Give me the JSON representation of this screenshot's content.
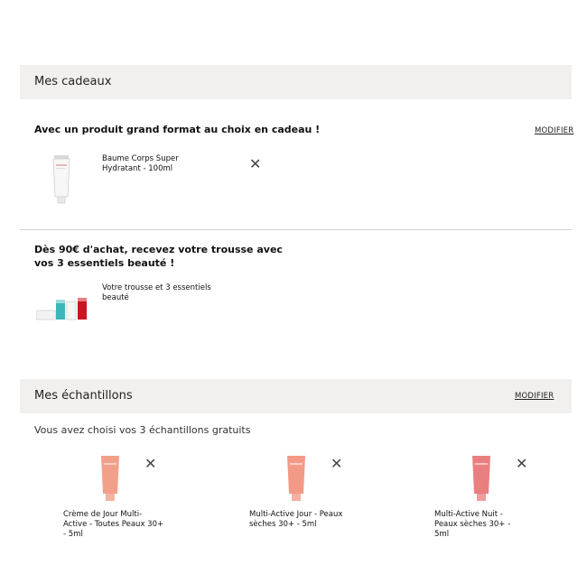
{
  "gifts": {
    "header_title": "Mes cadeaux",
    "offer1": {
      "title": "Avec un produit grand format au choix en cadeau !",
      "modify_label": "MODIFIER",
      "item_name": "Baume Corps Super Hydratant - 100ml",
      "image_icon": "white-body-balm-tube-icon",
      "remove_icon": "close-icon"
    },
    "offer2": {
      "title": "Dès 90€ d'achat, recevez votre trousse avec vos 3 essentiels beauté !",
      "item_name": "Votre trousse et 3 essentiels beauté",
      "image_icon": "pouch-and-three-minis-icon"
    }
  },
  "samples": {
    "header_title": "Mes échantillons",
    "modify_label": "MODIFIER",
    "subtitle": "Vous avez choisi vos 3 échantillons gratuits",
    "items": [
      {
        "name": "Crème de Jour Multi-Active - Toutes Peaux 30+ - 5ml",
        "tube_color": "#f2a08a",
        "remove_icon": "close-icon"
      },
      {
        "name": "Multi-Active Jour - Peaux sèches 30+ - 5ml",
        "tube_color": "#f29a86",
        "remove_icon": "close-icon"
      },
      {
        "name": "Multi-Active Nuit - Peaux sèches 30+ - 5ml",
        "tube_color": "#ea7f80",
        "remove_icon": "close-icon"
      }
    ]
  }
}
